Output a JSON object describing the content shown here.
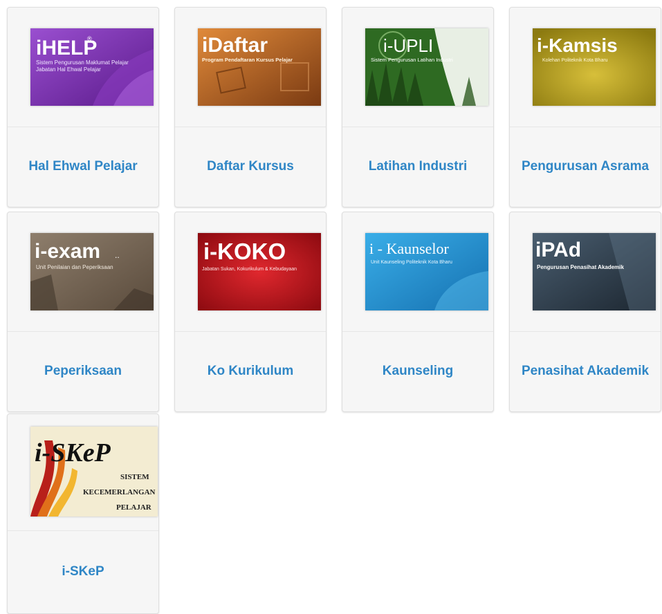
{
  "tiles": [
    {
      "label": "Hal Ehwal Pelajar",
      "logo": "iHELP",
      "logo_sup": "®",
      "subtitle": "Sistem Pengurusan Maklumat Pelajar",
      "subtitle2": "Jabatan Hal Ehwal Pelajar",
      "color": "#7a2fa8"
    },
    {
      "label": "Daftar Kursus",
      "logo": "iDaftar",
      "subtitle": "Program Pendaftaran Kursus Pelajar",
      "color": "#c06a2a"
    },
    {
      "label": "Latihan Industri",
      "logo": "i-UPLI",
      "subtitle": "Sistem Pengurusan Latihan Industri",
      "color": "#2f6b2a"
    },
    {
      "label": "Pengurusan Asrama",
      "logo": "i-Kamsis",
      "subtitle": "Kolehan Politeknik Kota Bharu",
      "color": "#b49d22"
    },
    {
      "label": "Peperiksaan",
      "logo": "i-exam",
      "logo_suffix": "..",
      "subtitle": "Unit Penilaian dan Peperiksaan",
      "color": "#7b6a58"
    },
    {
      "label": "Ko Kurikulum",
      "logo": "i-KOKO",
      "subtitle": "Jabatan Sukan, Kokurikulum & Kebudayaan",
      "color": "#c0161c"
    },
    {
      "label": "Kaunseling",
      "logo": "i - Kaunselor",
      "subtitle": "Unit Kaunseling Politeknik Kota Bharu",
      "color": "#1f8fd0"
    },
    {
      "label": "Penasihat Akademik",
      "logo": "iPAd",
      "subtitle": "Pengurusan Penasihat Akademik",
      "color": "#2f4050"
    },
    {
      "label": "i-SKeP",
      "logo": "i-SKeP",
      "subtitle": "SISTEM",
      "subtitle2": "KECEMERLANGAN",
      "subtitle3": "PELAJAR",
      "color": "#f1e9c8"
    }
  ]
}
